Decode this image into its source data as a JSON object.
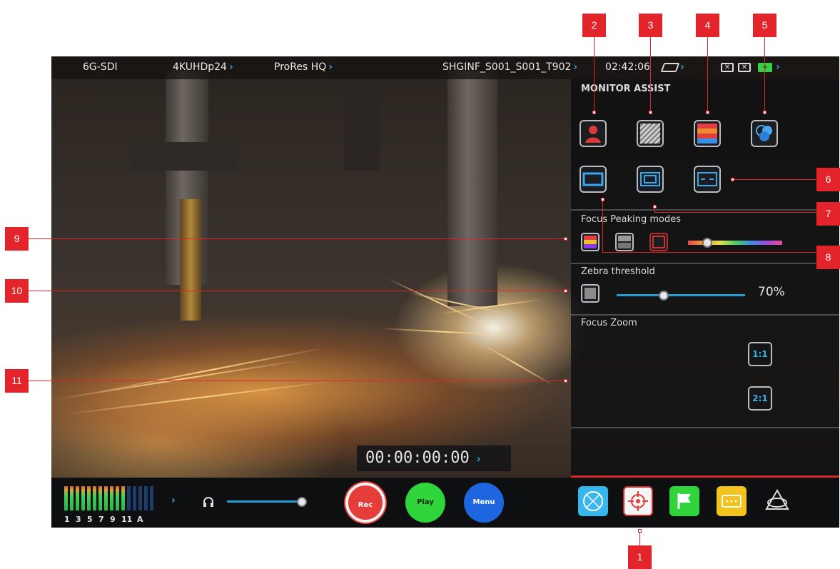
{
  "status_bar": {
    "input": "6G-SDI",
    "format": "4KUHDp24",
    "codec": "ProRes HQ",
    "clip_name": "SHGINF_S001_S001_T902",
    "time_remaining": "02:42:06",
    "chevron": "›"
  },
  "panel": {
    "monitor_assist_title": "MONITOR ASSIST",
    "focus_peaking_title": "Focus Peaking modes",
    "zebra_title": "Zebra threshold",
    "zebra_value_text": "70%",
    "zebra_value": 0.7,
    "focus_zoom_title": "Focus Zoom",
    "zoom_1_label": "1:1",
    "zoom_2_label": "2:1",
    "monitor_assist_icons": [
      "false-color-icon",
      "zebra-icon",
      "waveform-icon",
      "color-channels-icon",
      "frame-guides-icon",
      "safe-area-icon",
      "anamorphic-icon"
    ],
    "peaking_icons": [
      "color-peaking-icon",
      "mono-peaking-icon",
      "edge-peaking-icon"
    ]
  },
  "timecode": "00:00:00:00",
  "bottom_bar": {
    "audio_channel_labels": [
      "1",
      "3",
      "5",
      "7",
      "9",
      "11",
      "A"
    ],
    "rec_label": "Rec",
    "play_label": "Play",
    "menu_label": "Menu",
    "headphone_icon": "headphones-icon",
    "app_icons": [
      "network-icon",
      "monitor-assist-icon",
      "flag-icon",
      "timecode-icon",
      "atomos-logo-icon"
    ]
  },
  "callouts": [
    "1",
    "2",
    "3",
    "4",
    "5",
    "6",
    "7",
    "8",
    "9",
    "10",
    "11"
  ],
  "colors": {
    "accent_blue": "#2aa8e8",
    "callout_red": "#e3242b",
    "rec_red": "#e43d3a",
    "play_green": "#2fd53b",
    "menu_blue": "#1e66e0"
  }
}
